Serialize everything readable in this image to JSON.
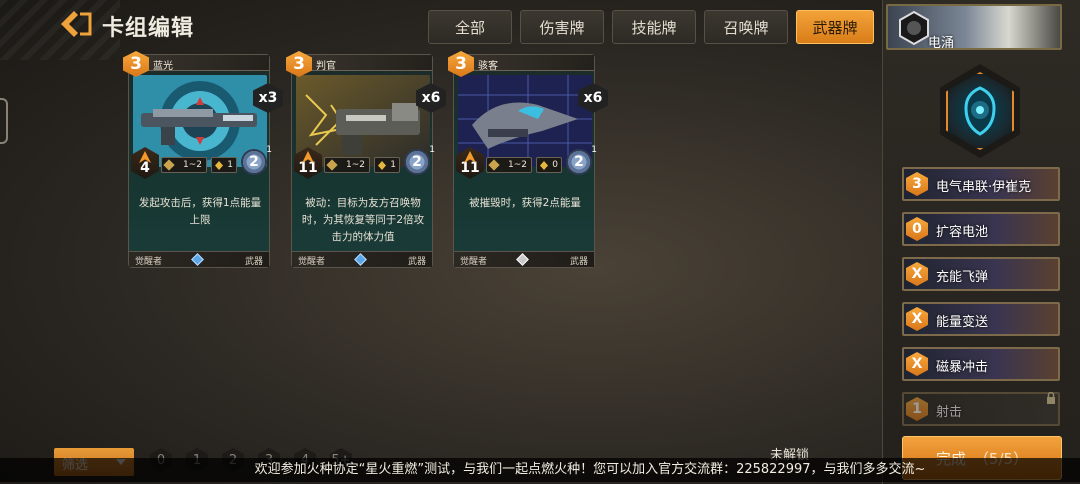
{
  "header": {
    "title": "卡组编辑"
  },
  "tabs": [
    {
      "label": "全部",
      "active": false
    },
    {
      "label": "伤害牌",
      "active": false
    },
    {
      "label": "技能牌",
      "active": false
    },
    {
      "label": "召唤牌",
      "active": false
    },
    {
      "label": "武器牌",
      "active": true
    }
  ],
  "cards": [
    {
      "name": "蓝光",
      "cost": "3",
      "count": "x3",
      "attack": "4",
      "range": "1~2",
      "energy": "1",
      "durability": "2",
      "durability_sub": "1",
      "desc": "发起攻击后，获得1点能量上限",
      "type_left": "觉醒者",
      "type_right": "武器",
      "gem": "blue"
    },
    {
      "name": "判官",
      "cost": "3",
      "count": "x6",
      "attack": "11",
      "range": "1~2",
      "energy": "1",
      "durability": "2",
      "durability_sub": "1",
      "desc": "被动：目标为友方召唤物时，为其恢复等同于2倍攻击力的体力值",
      "type_left": "觉醒者",
      "type_right": "武器",
      "gem": "blue"
    },
    {
      "name": "骇客",
      "cost": "3",
      "count": "x6",
      "attack": "11",
      "range": "1~2",
      "energy": "0",
      "durability": "2",
      "durability_sub": "1",
      "desc": "被摧毁时，获得2点能量",
      "type_left": "觉醒者",
      "type_right": "武器",
      "gem": "grey"
    }
  ],
  "hero": {
    "name": "电涌"
  },
  "deck": [
    {
      "cost": "3",
      "name": "电气串联·伊崔克",
      "locked": false
    },
    {
      "cost": "0",
      "name": "扩容电池",
      "locked": false
    },
    {
      "cost": "X",
      "name": "充能飞弹",
      "locked": false
    },
    {
      "cost": "X",
      "name": "能量变送",
      "locked": false
    },
    {
      "cost": "X",
      "name": "磁暴冲击",
      "locked": false
    },
    {
      "cost": "1",
      "name": "射击",
      "locked": true
    }
  ],
  "done_button": {
    "label": "完成",
    "progress": "（5/5）"
  },
  "filter": {
    "label": "筛选"
  },
  "cost_filters": [
    "0",
    "1",
    "2",
    "3",
    "4",
    "5+"
  ],
  "unlock_label": "未解锁",
  "ticker": "欢迎参加火种协定“星火重燃”测试，与我们一起点燃火种！您可以加入官方交流群：225822997，与我们多多交流~",
  "colors": {
    "accent": "#f09a30",
    "panel": "#2e2a24"
  }
}
